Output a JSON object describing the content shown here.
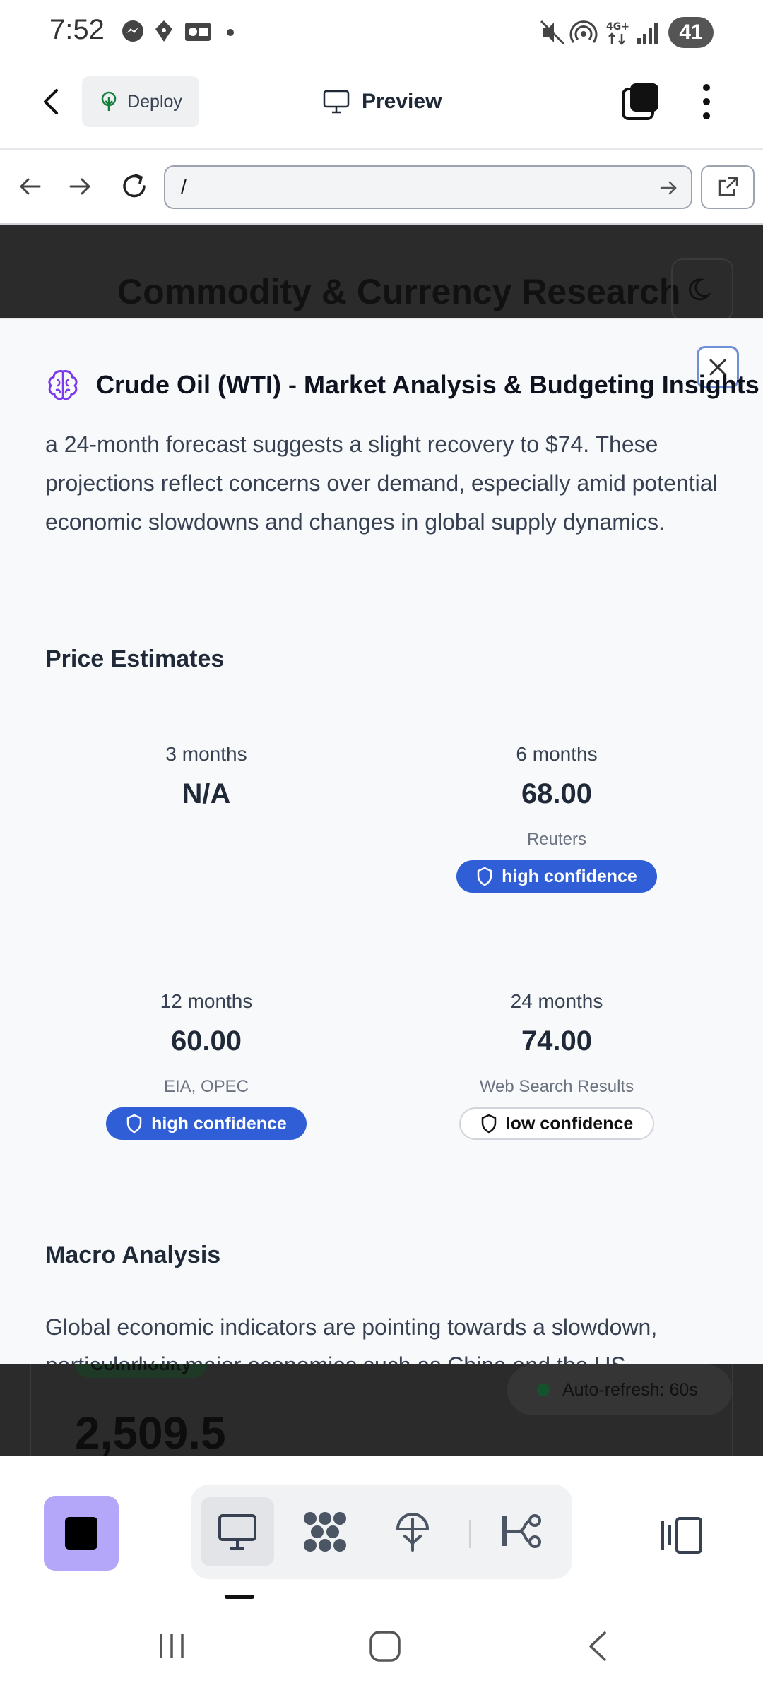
{
  "status_bar": {
    "time": "7:52",
    "battery": "41"
  },
  "app_bar": {
    "deploy_label": "Deploy",
    "preview_label": "Preview"
  },
  "url_bar": {
    "url": "/"
  },
  "background_page": {
    "title": "Commodity & Currency Research",
    "tag": "Commodity",
    "price": "2,509.5",
    "auto_refresh": "Auto-refresh: 60s"
  },
  "modal": {
    "title": "Crude Oil (WTI) - Market Analysis & Budgeting Insights",
    "intro": "a 24-month forecast suggests a slight recovery to $74. These projections reflect concerns over demand, especially amid potential economic slowdowns and changes in global supply dynamics.",
    "price_estimates_heading": "Price Estimates",
    "estimates": [
      {
        "period": "3 months",
        "value": "N/A",
        "source": "",
        "confidence": ""
      },
      {
        "period": "6 months",
        "value": "68.00",
        "source": "Reuters",
        "confidence": "high confidence"
      },
      {
        "period": "12 months",
        "value": "60.00",
        "source": "EIA, OPEC",
        "confidence": "high confidence"
      },
      {
        "period": "24 months",
        "value": "74.00",
        "source": "Web Search Results",
        "confidence": "low confidence"
      }
    ],
    "macro_heading": "Macro Analysis",
    "macro_text": "Global economic indicators are pointing towards a slowdown, particularly in major economies such as China and the US."
  },
  "colors": {
    "accent": "#2f5ed6",
    "stop_button": "#b4a6f8",
    "brain_icon": "#7c3aed",
    "deploy_icon": "#15803d"
  }
}
